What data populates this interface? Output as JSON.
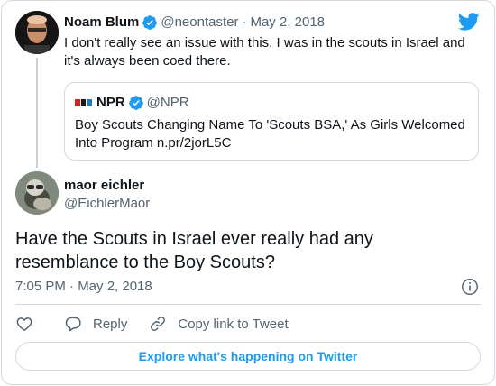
{
  "colors": {
    "accent": "#1d9bf0",
    "text_primary": "#0f1419",
    "text_secondary": "#536471",
    "border": "#cfd9de"
  },
  "parent_tweet": {
    "name": "Noam Blum",
    "handle": "@neontaster",
    "separator": "·",
    "date": "May 2, 2018",
    "text": "I don't really see an issue with this. I was in the scouts in Israel and it's always been coed there."
  },
  "quoted_tweet": {
    "name": "NPR",
    "handle": "@NPR",
    "text": "Boy Scouts Changing Name To 'Scouts BSA,' As Girls Welcomed Into Program n.pr/2jorL5C"
  },
  "main_tweet": {
    "name": "maor eichler",
    "handle": "@EichlerMaor",
    "text": "Have the Scouts in Israel ever really had any resemblance to the Boy Scouts?",
    "timestamp": "7:05 PM · May 2, 2018"
  },
  "actions": {
    "like_icon": "heart-icon",
    "reply_label": "Reply",
    "copy_link_label": "Copy link to Tweet"
  },
  "explore_label": "Explore what's happening on Twitter"
}
